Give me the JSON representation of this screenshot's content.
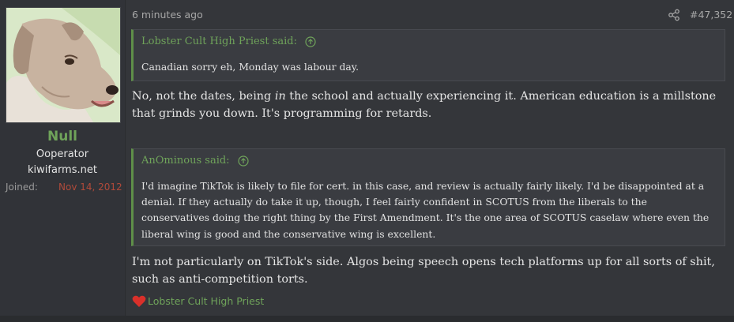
{
  "user": {
    "name": "Null",
    "title": "Ooperator",
    "banner": "kiwifarms.net",
    "joined_label": "Joined:",
    "joined_value": "Nov 14, 2012"
  },
  "post": {
    "time": "6 minutes ago",
    "number": "#47,352",
    "quotes": [
      {
        "author": "Lobster Cult High Priest said:",
        "text": "Canadian sorry eh, Monday was labour day."
      },
      {
        "author": "AnOminous said:",
        "text": "I'd imagine TikTok is likely to file for cert. in this case, and review is actually fairly likely. I'd be disappointed at a denial. If they actually do take it up, though, I feel fairly confident in SCOTUS from the liberals to the conservatives doing the right thing by the First Amendment. It's the one area of SCOTUS caselaw where even the liberal wing is good and the conservative wing is excellent."
      }
    ],
    "reply1_a": "No, not the dates, being ",
    "reply1_em": "in",
    "reply1_b": " the school and actually experiencing it. American education is a millstone that grinds you down. It's programming for retards.",
    "reply2": "I'm not particularly on TikTok's side. Algos being speech opens tech platforms up for all sorts of shit, such as anti-competition torts.",
    "reaction_user": "Lobster Cult High Priest"
  },
  "icons": {
    "share": "share-icon",
    "quote_jump": "arrow-up-circle-icon",
    "reaction": "heart-icon"
  },
  "colors": {
    "accent": "#6fa35a",
    "joined_date": "#b04a3a",
    "background": "#34363a"
  }
}
